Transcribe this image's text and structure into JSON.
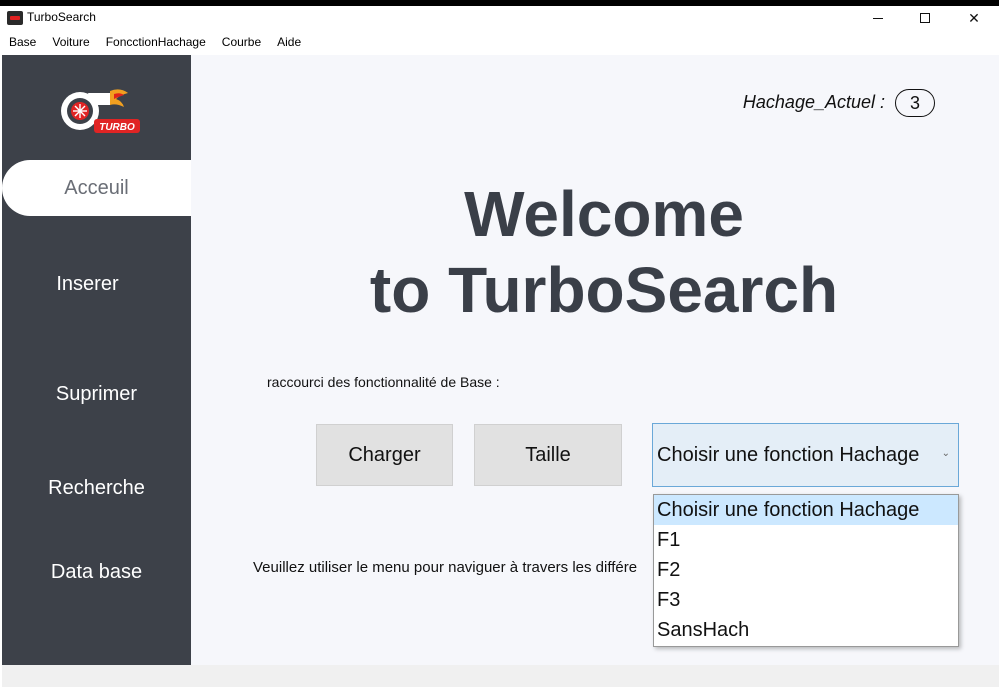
{
  "window": {
    "title": "TurboSearch",
    "minimize": "–",
    "maximize": "☐",
    "close": "✕"
  },
  "menu": [
    "Base",
    "Voiture",
    "FoncctionHachage",
    "Courbe",
    "Aide"
  ],
  "sidebar": {
    "logo_text": "TURBO",
    "items": [
      {
        "label": "Acceuil",
        "active": true
      },
      {
        "label": "Inserer"
      },
      {
        "label": "Suprimer"
      },
      {
        "label": "Recherche"
      },
      {
        "label": "Data base"
      }
    ]
  },
  "main": {
    "hash_label": "Hachage_Actuel :",
    "hash_value": "3",
    "welcome_line1": "Welcome",
    "welcome_line2": "to TurboSearch",
    "shortcuts_label": "raccourci des fonctionnalité de Base :",
    "charger_label": "Charger",
    "taille_label": "Taille",
    "combo_value": "Choisir une fonction Hachage",
    "combo_options": [
      "Choisir une fonction Hachage",
      "F1",
      "F2",
      "F3",
      "SansHach"
    ],
    "info_text": "Veuillez utiliser le menu pour naviguer à travers les différe"
  },
  "colors": {
    "sidebar_bg": "#3d4149",
    "main_bg": "#f6f7fb",
    "title_text": "#3a3f48",
    "combo_border": "#6aa8d8",
    "option_selected": "#cce8ff"
  }
}
